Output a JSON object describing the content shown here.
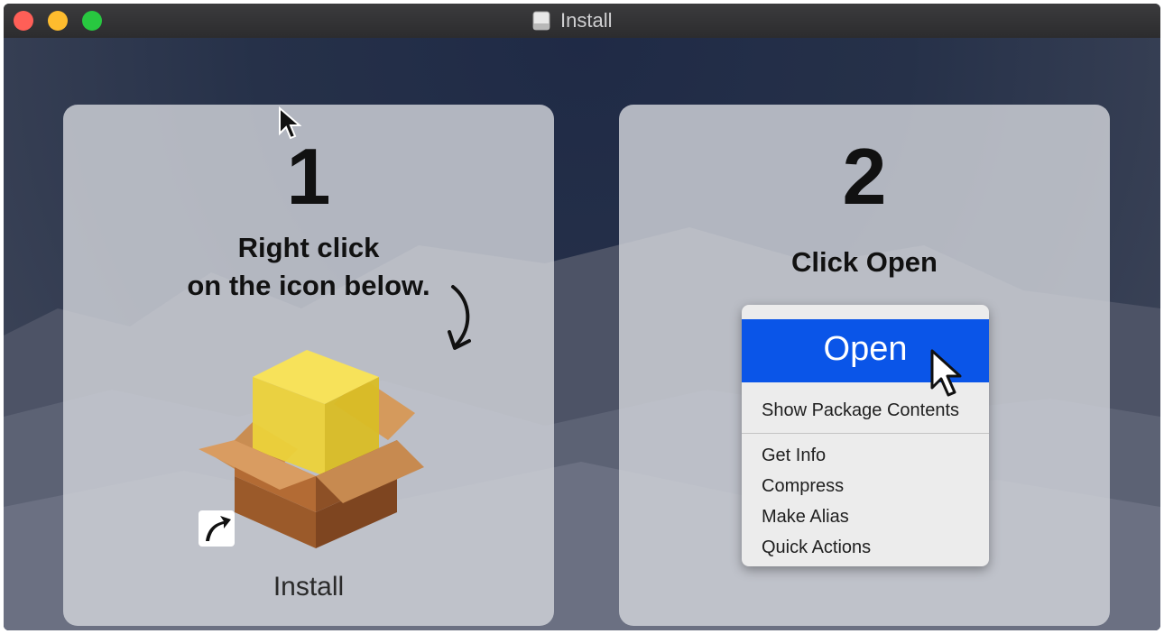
{
  "window": {
    "title": "Install",
    "controls": [
      "close",
      "minimize",
      "zoom"
    ],
    "title_icon": "disk-icon"
  },
  "step1": {
    "number": "1",
    "instruction_line1": "Right click",
    "instruction_line2": "on the icon below.",
    "icon": "package-icon",
    "icon_label": "Install"
  },
  "step2": {
    "number": "2",
    "instruction": "Click Open",
    "menu": {
      "open_label": "Open",
      "items": [
        "Show Package Contents",
        "Get Info",
        "Compress",
        "Make Alias",
        "Quick Actions"
      ]
    }
  },
  "colors": {
    "highlight": "#0a55e8",
    "close": "#ff5f57",
    "minimize": "#febc2e",
    "zoom": "#28c840"
  }
}
